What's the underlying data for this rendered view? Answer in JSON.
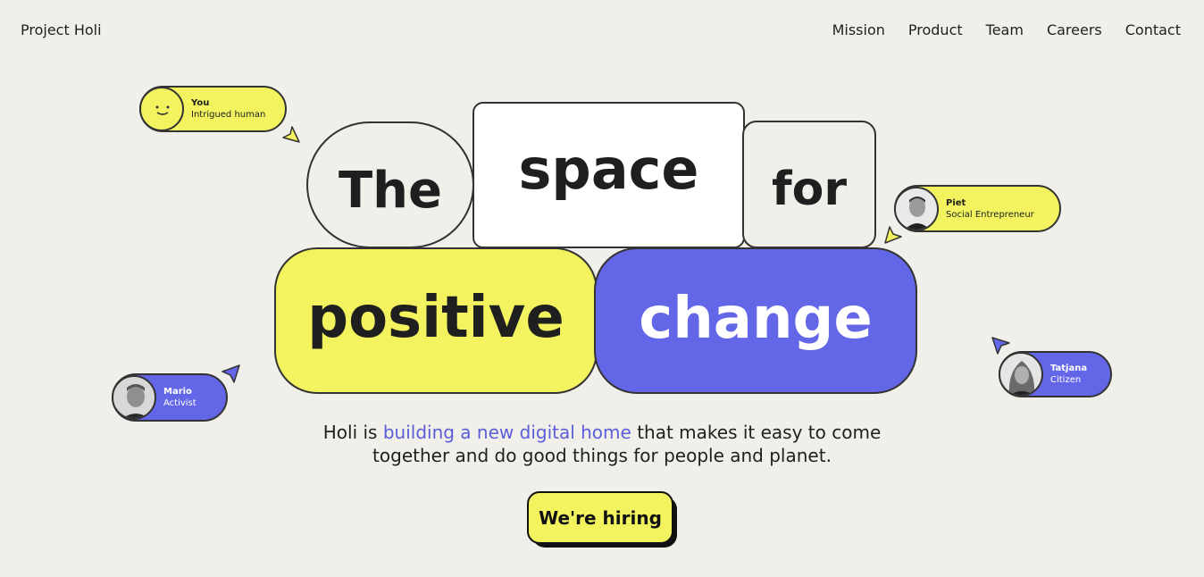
{
  "header": {
    "brand": "Project Holi",
    "nav": [
      "Mission",
      "Product",
      "Team",
      "Careers",
      "Contact"
    ]
  },
  "hero": {
    "words": [
      "The",
      "space",
      "for",
      "positive",
      "change"
    ]
  },
  "people": [
    {
      "name": "You",
      "role": "Intrigued human"
    },
    {
      "name": "Piet",
      "role": "Social Entrepreneur"
    },
    {
      "name": "Mario",
      "role": "Activist"
    },
    {
      "name": "Tatjana",
      "role": "Citizen"
    }
  ],
  "tagline": {
    "pre": "Holi is ",
    "highlight": "building a new digital home",
    "post": " that makes it easy to come together and do good things for people and planet."
  },
  "cta": {
    "label": "We're hiring"
  },
  "colors": {
    "background": "#f0efea",
    "yellow": "#f2f35f",
    "purple": "#6466e8",
    "link": "#5b5ed8",
    "outline": "#333333"
  },
  "icons": [
    "smiley-icon",
    "cursor-arrow-icon",
    "avatar-photo"
  ]
}
